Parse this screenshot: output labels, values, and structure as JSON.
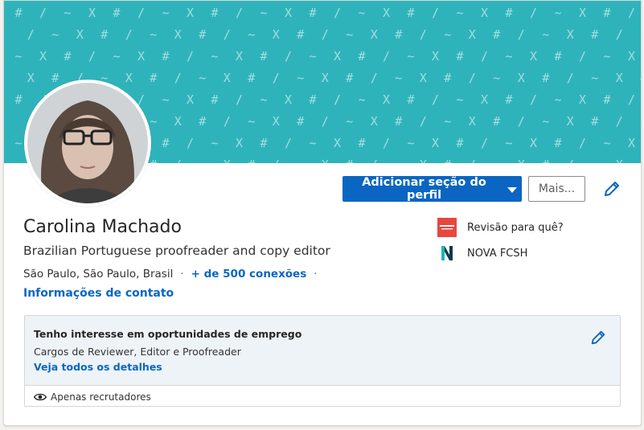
{
  "profile": {
    "name": "Carolina Machado",
    "headline": "Brazilian Portuguese proofreader and copy editor",
    "location": "São Paulo, São Paulo, Brasil",
    "separator": "·",
    "connections": "+ de 500 conexões",
    "contact_info": "Informações de contato"
  },
  "actions": {
    "add_section_label": "Adicionar seção do perfil",
    "more_label": "Mais..."
  },
  "experience": [
    {
      "label": "Revisão para quê?",
      "icon": "revisao-logo-icon"
    },
    {
      "label": "NOVA FCSH",
      "icon": "nova-fcsh-logo-icon"
    }
  ],
  "open_to_work": {
    "title": "Tenho interesse em oportunidades de emprego",
    "roles": "Cargos de Reviewer, Editor e Proofreader",
    "details_link": "Veja todos os detalhes",
    "visibility": "Apenas recrutadores"
  },
  "banner": {
    "pattern_glyphs": [
      "#",
      "/",
      "~",
      "X"
    ]
  },
  "colors": {
    "banner": "#2fb3bb",
    "primary": "#0a66c2",
    "card_bg": "#ffffff",
    "otw_bg": "#eef3f8"
  }
}
